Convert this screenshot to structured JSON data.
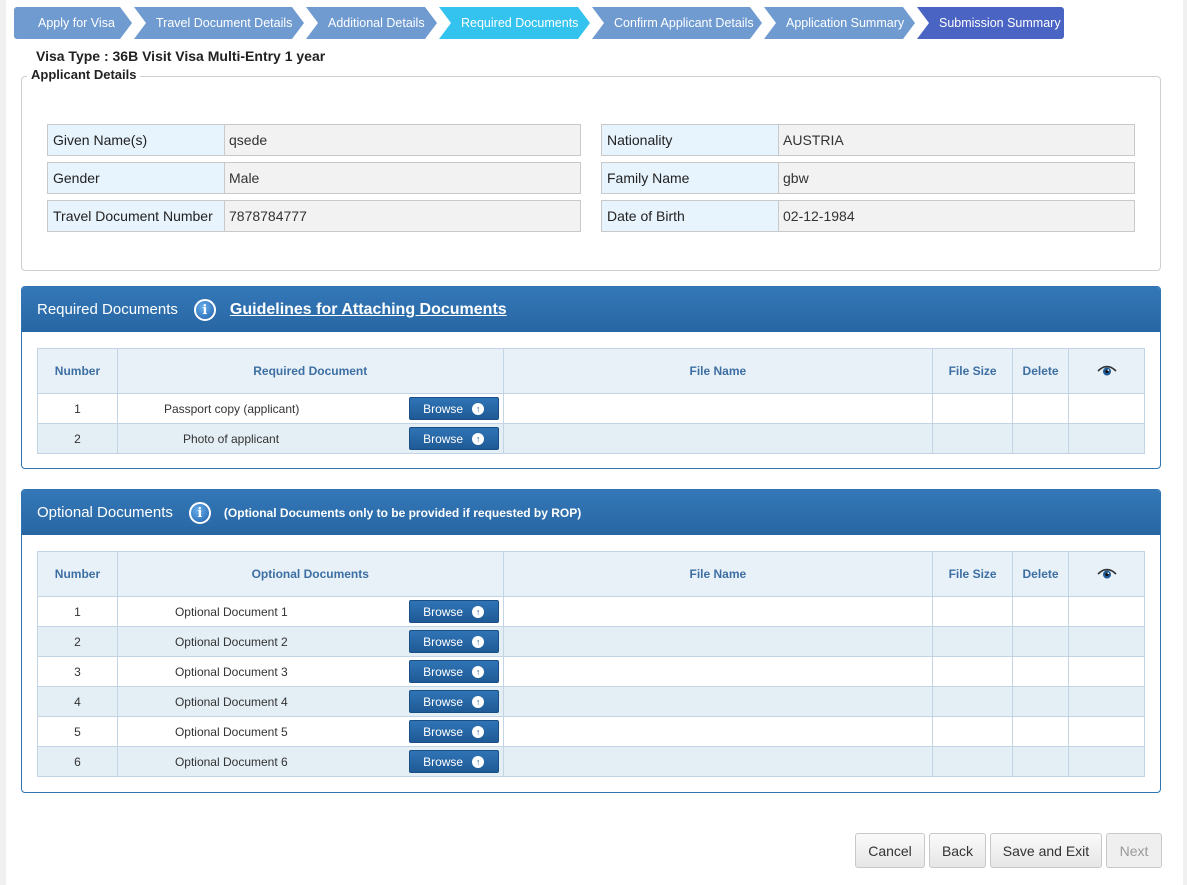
{
  "steps": [
    {
      "label": "Apply for Visa",
      "state": "done"
    },
    {
      "label": "Travel Document Details",
      "state": "done"
    },
    {
      "label": "Additional Details",
      "state": "done"
    },
    {
      "label": "Required Documents",
      "state": "active"
    },
    {
      "label": "Confirm Applicant Details",
      "state": "done"
    },
    {
      "label": "Application Summary",
      "state": "done"
    },
    {
      "label": "Submission Summary",
      "state": "final"
    }
  ],
  "visa_type": {
    "label": "Visa Type",
    "value": ": 36B Visit Visa Multi-Entry 1 year"
  },
  "applicant": {
    "legend": "Applicant Details",
    "fields": {
      "given_name": {
        "label": "Given Name(s)",
        "value": "qsede"
      },
      "gender": {
        "label": "Gender",
        "value": "Male"
      },
      "travel_doc": {
        "label": "Travel Document Number",
        "value": "7878784777"
      },
      "nationality": {
        "label": "Nationality",
        "value": "AUSTRIA"
      },
      "family_name": {
        "label": "Family Name",
        "value": "gbw"
      },
      "dob": {
        "label": "Date of Birth",
        "value": "02-12-1984"
      }
    }
  },
  "required": {
    "title": "Required Documents",
    "guide_link": "Guidelines for Attaching Documents",
    "headers": {
      "number": "Number",
      "document": "Required Document",
      "file_name": "File Name",
      "file_size": "File Size",
      "delete": "Delete"
    },
    "rows": [
      {
        "number": "1",
        "name": "Passport copy (applicant)"
      },
      {
        "number": "2",
        "name": "Photo of applicant"
      }
    ]
  },
  "optional": {
    "title": "Optional Documents",
    "note": "(Optional Documents only to be provided if requested by ROP)",
    "headers": {
      "number": "Number",
      "document": "Optional Documents",
      "file_name": "File Name",
      "file_size": "File Size",
      "delete": "Delete"
    },
    "rows": [
      {
        "number": "1",
        "name": "Optional Document 1"
      },
      {
        "number": "2",
        "name": "Optional Document 2"
      },
      {
        "number": "3",
        "name": "Optional Document 3"
      },
      {
        "number": "4",
        "name": "Optional Document 4"
      },
      {
        "number": "5",
        "name": "Optional Document 5"
      },
      {
        "number": "6",
        "name": "Optional Document 6"
      }
    ]
  },
  "browse_label": "Browse",
  "icons": {
    "info": "info-icon",
    "view": "eye-icon",
    "upload": "upload-icon"
  },
  "footer": {
    "cancel": "Cancel",
    "back": "Back",
    "save_exit": "Save and Exit",
    "next": "Next"
  }
}
